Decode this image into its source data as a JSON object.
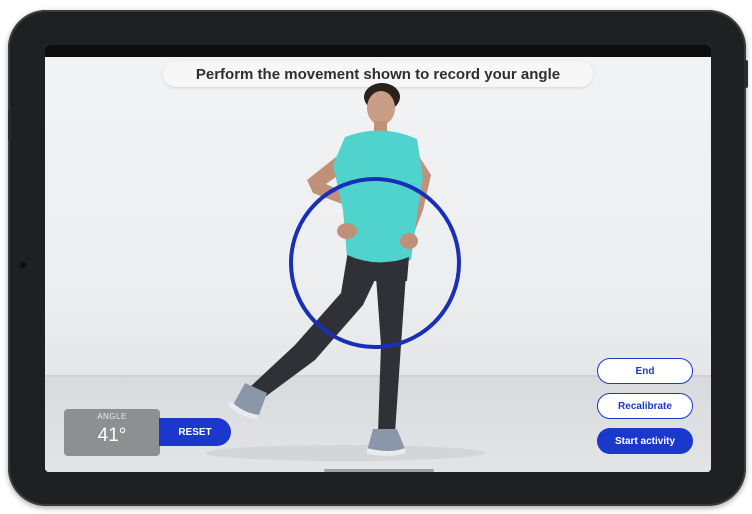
{
  "instruction": {
    "text": "Perform the movement shown to record your angle"
  },
  "angle": {
    "label": "ANGLE",
    "value": "41°"
  },
  "buttons": {
    "reset": "RESET",
    "end": "End",
    "recalibrate": "Recalibrate",
    "start": "Start activity"
  },
  "colors": {
    "accent": "#1a38cc",
    "ring": "#1a2fb8",
    "shirt": "#4fd3cc",
    "leggings": "#2f3136",
    "angle_box": "#8a8b8d"
  },
  "icons": [
    "tracking-ring"
  ]
}
